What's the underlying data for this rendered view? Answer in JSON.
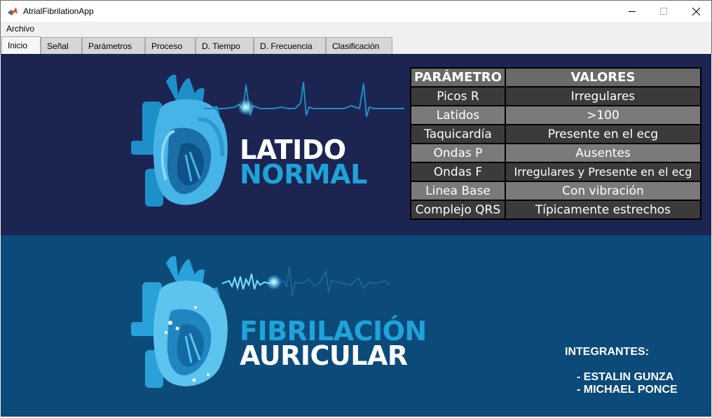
{
  "window": {
    "title": "AtrialFibrilationApp",
    "icon": "matlab-icon",
    "controls": [
      "minimize-icon",
      "maximize-icon",
      "close-icon"
    ]
  },
  "menu": {
    "items": [
      {
        "label": "Archivo"
      }
    ]
  },
  "tabs": [
    {
      "label": "Inicio",
      "active": true
    },
    {
      "label": "Señal"
    },
    {
      "label": "Parámetros"
    },
    {
      "label": "Proceso"
    },
    {
      "label": "D. Tiempo"
    },
    {
      "label": "D. Frecuencia"
    },
    {
      "label": "Clasificación"
    }
  ],
  "banner": {
    "top": {
      "line1": "LATIDO",
      "line2": "NORMAL"
    },
    "bottom": {
      "line1": "FIBRILACIÓN",
      "line2": "AURICULAR"
    }
  },
  "table": {
    "headers": [
      "PARÁMETRO",
      "VALORES"
    ],
    "rows": [
      [
        "Picos R",
        "Irregulares"
      ],
      [
        "Latidos",
        ">100"
      ],
      [
        "Taquicardía",
        "Presente en el ecg"
      ],
      [
        "Ondas P",
        "Ausentes"
      ],
      [
        "Ondas F",
        "Irregulares y Presente en el ecg"
      ],
      [
        "Linea Base",
        "Con vibración"
      ],
      [
        "Complejo QRS",
        "Típicamente estrechos"
      ]
    ]
  },
  "integrantes": {
    "title": "INTEGRANTES:",
    "members": [
      "- ESTALIN GUNZA",
      "- MICHAEL PONCE"
    ]
  },
  "colors": {
    "top_panel": "#1c2452",
    "bottom_panel": "#0c4a7a",
    "accent": "#1fa3d8"
  }
}
